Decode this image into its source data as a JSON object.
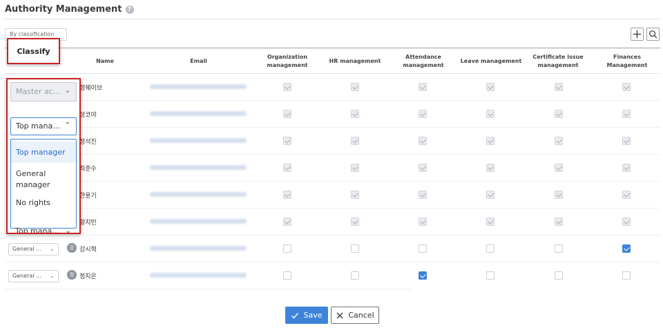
{
  "header": {
    "title": "Authority Management",
    "help_icon": "?"
  },
  "toolbar": {
    "filter_value": "By classification",
    "add_icon": "plus-icon",
    "search_icon": "search-icon"
  },
  "table": {
    "columns": {
      "name": "Name",
      "email": "Email",
      "organization": "Organization management",
      "hr": "HR management",
      "attendance": "Attendance management",
      "leave": "Leave management",
      "certificate": "Certificate issue management",
      "finances": "Finances Management"
    },
    "rows": [
      {
        "role": "",
        "name": "정웨이브",
        "email": "",
        "perms": [
          "disabled",
          "disabled",
          "disabled",
          "disabled",
          "disabled",
          "disabled"
        ]
      },
      {
        "role": "",
        "name": "성코야",
        "email": "",
        "perms": [
          "disabled",
          "disabled",
          "disabled",
          "disabled",
          "disabled",
          "disabled"
        ]
      },
      {
        "role": "",
        "name": "정석진",
        "email": "",
        "perms": [
          "disabled",
          "disabled",
          "disabled",
          "disabled",
          "disabled",
          "disabled"
        ]
      },
      {
        "role": "",
        "name": "최준수",
        "email": "",
        "perms": [
          "disabled",
          "disabled",
          "disabled",
          "disabled",
          "disabled",
          "disabled"
        ]
      },
      {
        "role": "",
        "name": "한윤기",
        "email": "",
        "perms": [
          "disabled",
          "disabled",
          "disabled",
          "disabled",
          "disabled",
          "disabled"
        ]
      },
      {
        "role": "",
        "name": "황지민",
        "email": "",
        "perms": [
          "disabled",
          "disabled",
          "disabled",
          "disabled",
          "disabled",
          "disabled"
        ]
      },
      {
        "role": "General ...",
        "avatar": "강",
        "name": "강시혁",
        "email": "",
        "perms": [
          "off",
          "off",
          "off",
          "off",
          "off",
          "on"
        ]
      },
      {
        "role": "General ...",
        "avatar": "정",
        "name": "정지은",
        "email": "",
        "perms": [
          "off",
          "off",
          "on",
          "off",
          "off",
          "off"
        ]
      }
    ]
  },
  "tooltip": {
    "label": "Classify"
  },
  "dropdown": {
    "first_select": "Master ac...",
    "second_select": "Top mana...",
    "options": [
      "Top manager",
      "General manager",
      "No rights"
    ],
    "selected": "Top manager",
    "ghost_select": "Top mana..."
  },
  "footer": {
    "save_label": "Save",
    "cancel_label": "Cancel"
  },
  "colors": {
    "accent": "#3d83d9",
    "highlight_border": "#c8201f"
  }
}
